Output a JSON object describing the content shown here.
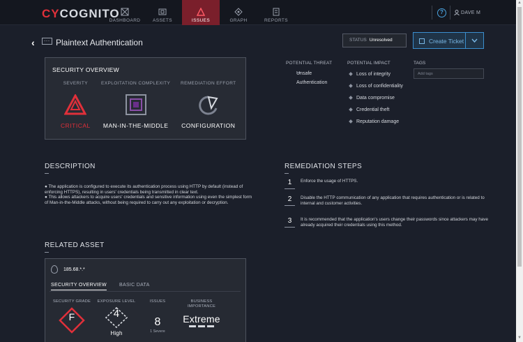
{
  "app": {
    "logo_cy": "CY",
    "logo_rest": "COGNITO",
    "user": "DAVE M",
    "help": "?"
  },
  "nav": [
    {
      "label": "DASHBOARD",
      "icon": "dashboard-icon"
    },
    {
      "label": "ASSETS",
      "icon": "assets-icon"
    },
    {
      "label": "ISSUES",
      "icon": "issues-icon",
      "active": true
    },
    {
      "label": "GRAPH",
      "icon": "graph-icon"
    },
    {
      "label": "REPORTS",
      "icon": "reports-icon"
    }
  ],
  "header": {
    "back": "‹",
    "title": "Plaintext Authentication",
    "status_label": "STATUS",
    "status_value": "Unresolved",
    "ticket_label": "Create Ticket",
    "ticket_dd": "⌄"
  },
  "overview": {
    "heading": "SECURITY OVERVIEW",
    "severity": {
      "header": "SEVERITY",
      "value": "CRITICAL",
      "color": "#e0303a"
    },
    "complexity": {
      "header": "EXPLOITATION COMPLEXITY",
      "value": "MAN-IN-THE-MIDDLE",
      "color": "#8a4fa8"
    },
    "effort": {
      "header": "REMEDIATION EFFORT",
      "value": "CONFIGURATION"
    }
  },
  "threat": {
    "header": "POTENTIAL THREAT",
    "line1": "Unsafe",
    "line2": "Authentication"
  },
  "impact": {
    "header": "POTENTIAL IMPACT",
    "items": [
      "Loss of integrity",
      "Loss of confidentiality",
      "Data compromise",
      "Credential theft",
      "Reputation damage"
    ]
  },
  "tags": {
    "header": "TAGS",
    "placeholder": "Add tags"
  },
  "description": {
    "header": "DESCRIPTION",
    "p1": "● The application is configured to execute its authentication process using HTTP by default (instead of enforcing HTTPS), resulting in users' credentials being transmitted in clear text.",
    "p2": "● This allows attackers to acquire users' credentials and sensitive information using even the simplest form of Man-in-the-Middle attacks, without being required to carry out any exploitation or decryption."
  },
  "remediation": {
    "header": "REMEDIATION STEPS",
    "steps": [
      {
        "n": "1",
        "text": "Enforce the usage of HTTPS."
      },
      {
        "n": "2",
        "text": "Disable the HTTP communication of any application that requires authentication or is related to internal and customer activities."
      },
      {
        "n": "3",
        "text": "It is recommended that the application's users change their passwords since attackers may have already acquired their credentials using this method."
      }
    ]
  },
  "related": {
    "header": "RELATED ASSET",
    "ip": "185.68.*.*",
    "tab1": "SECURITY OVERVIEW",
    "tab2": "BASIC DATA",
    "grade_header": "SECURITY GRADE",
    "grade": "F",
    "exposure_header": "EXPOSURE LEVEL",
    "exposure": "4",
    "exposure_label": "High",
    "issues_header": "ISSUES",
    "issues": "8",
    "issues_sub": "1 Severe",
    "importance_header1": "BUSINESS",
    "importance_header2": "IMPORTANCE",
    "importance": "Extreme"
  }
}
